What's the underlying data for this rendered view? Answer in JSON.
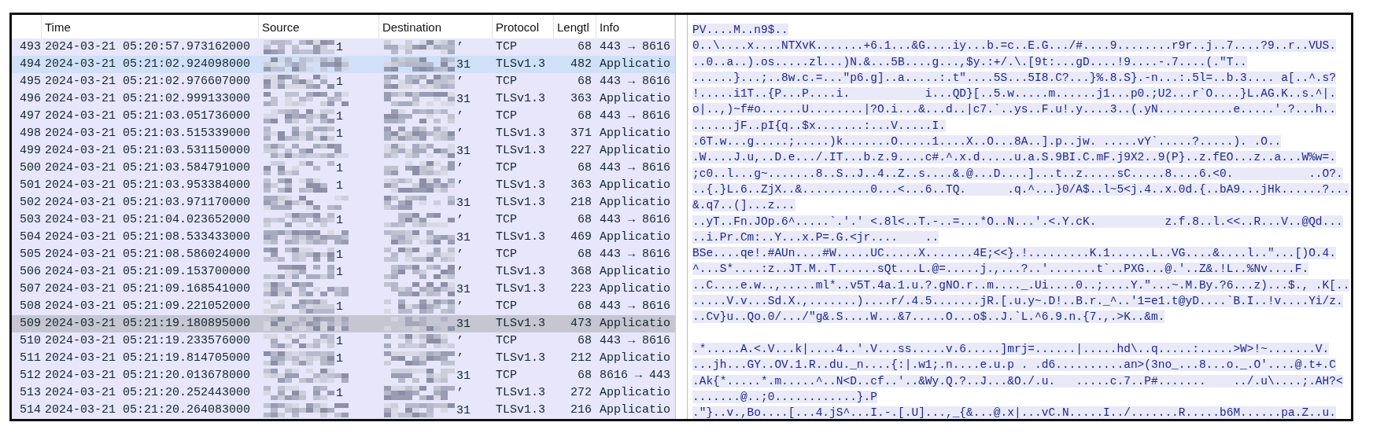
{
  "packet_list": {
    "columns": [
      "Time",
      "Source",
      "Destination",
      "Protocol",
      "Lengtl",
      "Info"
    ],
    "rows": [
      {
        "no": "493",
        "time": "2024-03-21 05:20:57.973162000",
        "source_tail": "1",
        "destination_tail": "’",
        "protocol": "TCP",
        "length": "68",
        "info": "443 → 8616",
        "selected": false,
        "hovered": false
      },
      {
        "no": "494",
        "time": "2024-03-21 05:21:02.924098000",
        "destination_tail": "31",
        "protocol": "TLSv1.3",
        "length": "482",
        "info": "Applicatio",
        "selected": false,
        "hovered": true
      },
      {
        "no": "495",
        "time": "2024-03-21 05:21:02.976607000",
        "source_tail": "1",
        "destination_tail": "’",
        "protocol": "TCP",
        "length": "68",
        "info": "443 → 8616",
        "selected": false,
        "hovered": false
      },
      {
        "no": "496",
        "time": "2024-03-21 05:21:02.999133000",
        "destination_tail": "31",
        "protocol": "TLSv1.3",
        "length": "363",
        "info": "Applicatio",
        "selected": false,
        "hovered": false
      },
      {
        "no": "497",
        "time": "2024-03-21 05:21:03.051736000",
        "source_tail": "1",
        "destination_tail": "’",
        "protocol": "TCP",
        "length": "68",
        "info": "443 → 8616",
        "selected": false,
        "hovered": false
      },
      {
        "no": "498",
        "time": "2024-03-21 05:21:03.515339000",
        "source_tail": "1",
        "destination_tail": "’",
        "protocol": "TLSv1.3",
        "length": "371",
        "info": "Applicatio",
        "selected": false,
        "hovered": false
      },
      {
        "no": "499",
        "time": "2024-03-21 05:21:03.531150000",
        "destination_tail": "31",
        "protocol": "TLSv1.3",
        "length": "227",
        "info": "Applicatio",
        "selected": false,
        "hovered": false
      },
      {
        "no": "500",
        "time": "2024-03-21 05:21:03.584791000",
        "source_tail": "1",
        "destination_tail": "’",
        "protocol": "TCP",
        "length": "68",
        "info": "443 → 8616",
        "selected": false,
        "hovered": false
      },
      {
        "no": "501",
        "time": "2024-03-21 05:21:03.953384000",
        "source_tail": "1",
        "destination_tail": "’",
        "protocol": "TLSv1.3",
        "length": "363",
        "info": "Applicatio",
        "selected": false,
        "hovered": false
      },
      {
        "no": "502",
        "time": "2024-03-21 05:21:03.971170000",
        "destination_tail": "31",
        "protocol": "TLSv1.3",
        "length": "218",
        "info": "Applicatio",
        "selected": false,
        "hovered": false
      },
      {
        "no": "503",
        "time": "2024-03-21 05:21:04.023652000",
        "source_tail": "1",
        "destination_tail": "’",
        "protocol": "TCP",
        "length": "68",
        "info": "443 → 8616",
        "selected": false,
        "hovered": false
      },
      {
        "no": "504",
        "time": "2024-03-21 05:21:08.533433000",
        "destination_tail": "31",
        "protocol": "TLSv1.3",
        "length": "469",
        "info": "Applicatio",
        "selected": false,
        "hovered": false
      },
      {
        "no": "505",
        "time": "2024-03-21 05:21:08.586024000",
        "source_tail": "1",
        "destination_tail": "’",
        "protocol": "TCP",
        "length": "68",
        "info": "443 → 8616",
        "selected": false,
        "hovered": false
      },
      {
        "no": "506",
        "time": "2024-03-21 05:21:09.153700000",
        "source_tail": "1",
        "destination_tail": "’",
        "protocol": "TLSv1.3",
        "length": "368",
        "info": "Applicatio",
        "selected": false,
        "hovered": false
      },
      {
        "no": "507",
        "time": "2024-03-21 05:21:09.168541000",
        "destination_tail": "31",
        "protocol": "TLSv1.3",
        "length": "223",
        "info": "Applicatio",
        "selected": false,
        "hovered": false
      },
      {
        "no": "508",
        "time": "2024-03-21 05:21:09.221052000",
        "source_tail": "1",
        "destination_tail": "’",
        "protocol": "TCP",
        "length": "68",
        "info": "443 → 8616",
        "selected": false,
        "hovered": false
      },
      {
        "no": "509",
        "time": "2024-03-21 05:21:19.180895000",
        "destination_tail": "31",
        "protocol": "TLSv1.3",
        "length": "473",
        "info": "Applicatio",
        "selected": true,
        "hovered": false
      },
      {
        "no": "510",
        "time": "2024-03-21 05:21:19.233576000",
        "source_tail": "1",
        "destination_tail": "’",
        "protocol": "TCP",
        "length": "68",
        "info": "443 → 8616",
        "selected": false,
        "hovered": false
      },
      {
        "no": "511",
        "time": "2024-03-21 05:21:19.814705000",
        "source_tail": "1",
        "destination_tail": "’",
        "protocol": "TLSv1.3",
        "length": "212",
        "info": "Applicatio",
        "selected": false,
        "hovered": false
      },
      {
        "no": "512",
        "time": "2024-03-21 05:21:20.013678000",
        "destination_tail": "31",
        "protocol": "TCP",
        "length": "68",
        "info": "8616 → 443",
        "selected": false,
        "hovered": false
      },
      {
        "no": "513",
        "time": "2024-03-21 05:21:20.252443000",
        "source_tail": "1",
        "destination_tail": "’",
        "protocol": "TLSv1.3",
        "length": "272",
        "info": "Applicatio",
        "selected": false,
        "hovered": false
      },
      {
        "no": "514",
        "time": "2024-03-21 05:21:20.264083000",
        "destination_tail": "31",
        "protocol": "TLSv1.3",
        "length": "216",
        "info": "Applicatio",
        "selected": false,
        "hovered": false
      }
    ]
  },
  "stream_view": {
    "blocks": [
      [
        "PV....M..n9$..",
        "0..\\....x....NTXvK.......+6.1...&G....iy...b.=c..E.G.../#....9........r9r..j..7....?9..r..VUS.",
        "..0..a..).os.....zl...)N.&...5B....g...,$y.:+/.\\.[9t:...gD....!9....-.7....(.\"T..",
        "......}...;..8w.c.=...\"p6.g]..a.....:.t\"....5S...5I8.C?...}%.8.S}.-n...:.5l=..b.3.... a[..^.s?",
        "!.....i1T..{P...P....i.           i...QD}[..5.w.....m......j1...p0.;U2...r`O....}L.AG.K..s.^|.",
        "o|..,)~f#o......U........|?O.i...&...d..|c7.`..ys..F.u!.y....3..(.yN...........e.....'.?...h..",
        "......jF..pI{q..$x.......:...V.....I.",
        ".6T.w...g.....;.....)k.......O.....1....X..O...8A..].p..jw. .....vY`.....?.....). .O..",
        ".W....J.u,..D.e.../.IT...b.z.9....c#.^.x.d.....u.a.S.9BI.C.mF.j9X2..9(P}..z.fEO...z..a...W%w=.",
        ";c0..l...g~.......8..S..J..4..Z..s....&.@...D....]...t..z.....sC.....8....6.<0.           ..O?.",
        "..{.}L.6..ZjX..&..........0...<...6..TQ.      .q.^...}0/A$..l~5<j.4..x.0d.{..bA9...jHk......?...",
        "&.q7..(]...z...",
        "..yT..Fn.JOp.6^.....`.'.' <.8l<..T.-..=...*O..N...'.<.Y.cK.          z.f.8..l.<<..R...V..@Qd...",
        "..i.Pr.Cm:..Y...x.P=.G.<jr....    ..",
        "BSe....qe!.#AUn....#W.....UC.....X.......4E;<<}.!.........K.1......L..VG....&....l..\"...[)O.4.",
        "^...S*....:z..JT.M..T......sQt...L.@=.....j.,...?..'.......t`..PXG...@.'..Z&.!L..%Nv....F.",
        "..C....e.w..,.....ml*..v5T.4a.1.u.?.gNO.r..m...._.Ui....0..;....Y.\"...~.M.By.?6...z)...$., .K[..",
        ".....V.v...Sd.X.,.......)....r/.4.5.......jR.[.u.y~.D!..B.r._^..'1=e1.t@yD....`B.I..!v....Yi/z.",
        "..Cv}u..Qo.0/.../\"g&.S....W...&7.....O...o$..J.`L.^6.9.n.{7.,.>K..&m."
      ],
      [
        ".*.....A.<.V...k|....4..'.V...ss.....v.6.....]mrj=......|.....hd\\..q.....:.....>W>!~.......V.",
        "...jh...GY..OV.1.R..du._n....{:|.w1;.n....e.u.p . .d6..........an>(3no_...8...o._.O'....@.t+.C",
        ".Ak{*.....*.m.....^..N<D..cf..'..&Wy.Q.?..J...&O./.u.   .....c.7..P#.......    ../.u\\....;.AH?<",
        ".......@..;0............}.P",
        ".\"}..v.,Bo....[...4.jS^...I.-.[.U]...,_{&...@.x|...vC.N.....I../.......R.....b6M......pa.Z..u."
      ]
    ]
  }
}
